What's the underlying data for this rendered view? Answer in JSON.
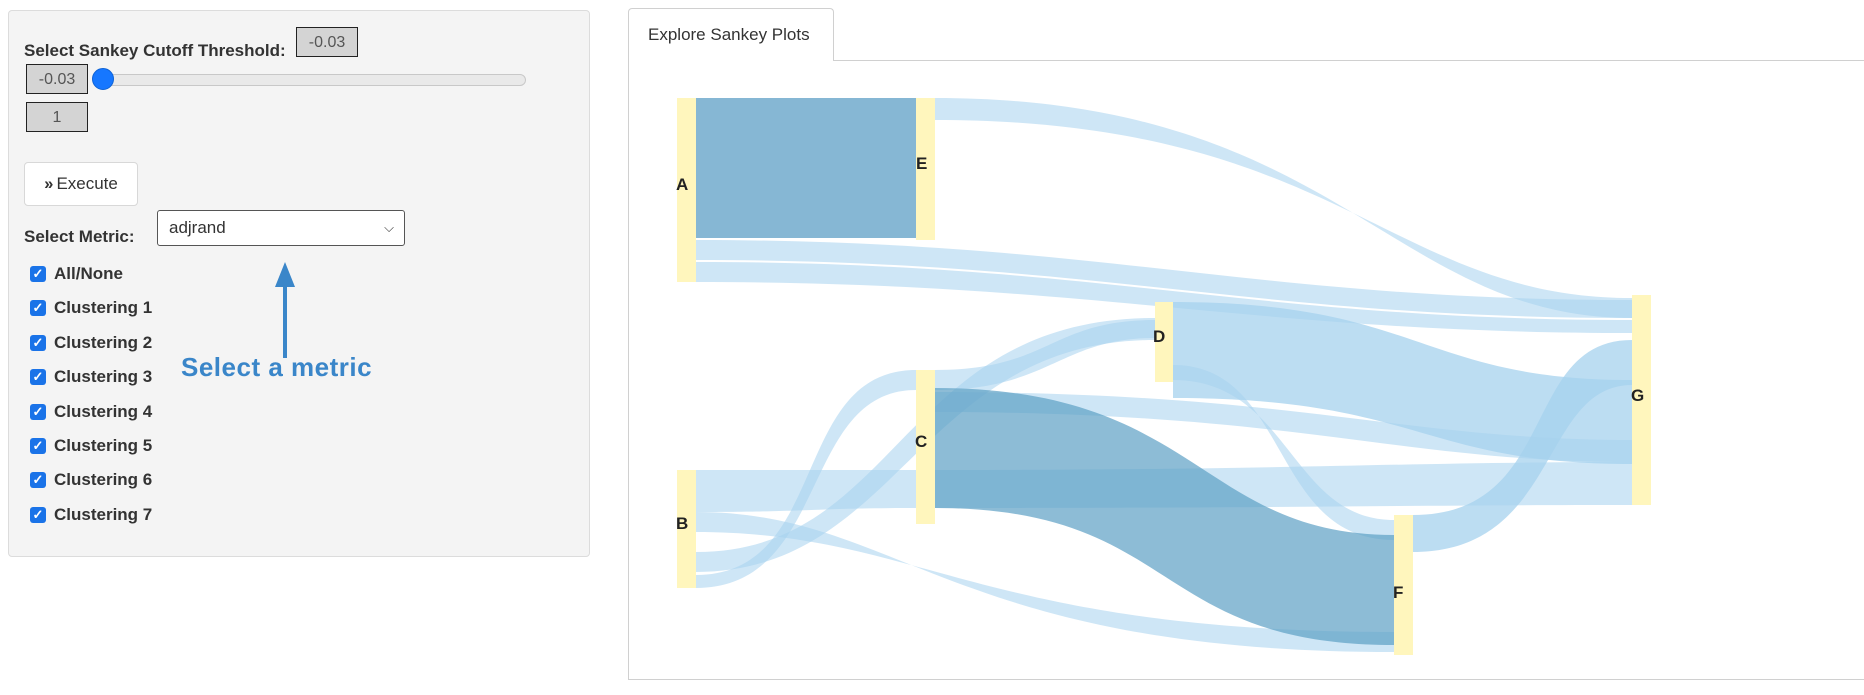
{
  "controls": {
    "threshold_label": "Select Sankey Cutoff Threshold:",
    "threshold_value": "-0.03",
    "slider_min": "-0.03",
    "slider_max": "1",
    "slider_fraction": 0.0,
    "execute_label": "Execute",
    "metric_label": "Select Metric:",
    "metric_value": "adjrand",
    "checkboxes": [
      {
        "label": "All/None",
        "checked": true
      },
      {
        "label": "Clustering 1",
        "checked": true
      },
      {
        "label": "Clustering 2",
        "checked": true
      },
      {
        "label": "Clustering 3",
        "checked": true
      },
      {
        "label": "Clustering 4",
        "checked": true
      },
      {
        "label": "Clustering 5",
        "checked": true
      },
      {
        "label": "Clustering 6",
        "checked": true
      },
      {
        "label": "Clustering 7",
        "checked": true
      }
    ]
  },
  "annotation": {
    "text": "Select a metric",
    "color": "#3a86c9"
  },
  "tabs": [
    {
      "label": "Explore Sankey Plots",
      "active": true
    }
  ],
  "sankey": {
    "node_color": "#fff6bd",
    "link_color": "#a6d2ee",
    "nodes": [
      "A",
      "B",
      "C",
      "D",
      "E",
      "F",
      "G"
    ]
  },
  "icons": {
    "execute": "double-chevron-right-icon",
    "select": "chevron-down-icon",
    "annotation": "arrow-up-icon"
  }
}
